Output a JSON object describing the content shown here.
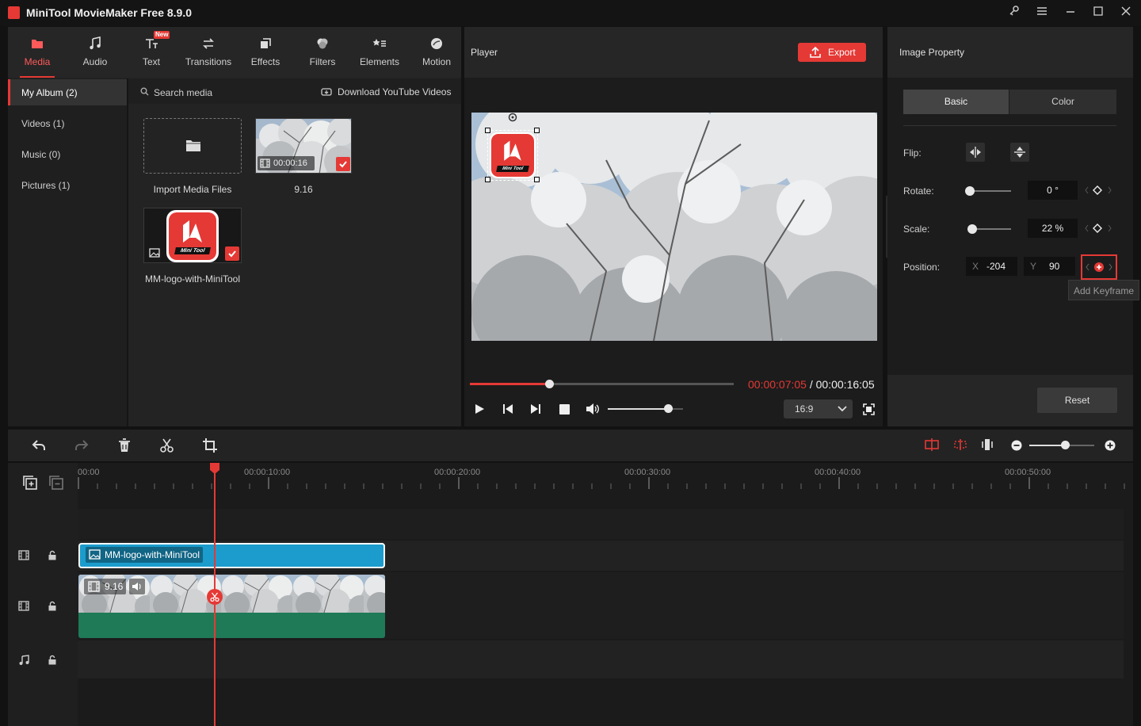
{
  "app": {
    "title": "MiniTool MovieMaker Free 8.9.0"
  },
  "toolbar": {
    "tabs": [
      {
        "label": "Media",
        "icon": "media-icon",
        "active": true
      },
      {
        "label": "Audio",
        "icon": "music-note-icon"
      },
      {
        "label": "Text",
        "icon": "text-icon",
        "badge": "New"
      },
      {
        "label": "Transitions",
        "icon": "transitions-icon"
      },
      {
        "label": "Effects",
        "icon": "effects-icon"
      },
      {
        "label": "Filters",
        "icon": "filters-icon"
      },
      {
        "label": "Elements",
        "icon": "elements-icon"
      },
      {
        "label": "Motion",
        "icon": "motion-icon"
      }
    ]
  },
  "library": {
    "albums": [
      {
        "label": "My Album (2)",
        "active": true
      },
      {
        "label": "Videos (1)"
      },
      {
        "label": "Music (0)"
      },
      {
        "label": "Pictures (1)"
      }
    ],
    "search_placeholder": "Search media",
    "download_label": "Download YouTube Videos",
    "items": [
      {
        "label": "Import Media Files"
      },
      {
        "label": "9.16",
        "duration": "00:00:16"
      },
      {
        "label": "MM-logo-with-MiniTool"
      }
    ]
  },
  "player": {
    "title": "Player",
    "export_label": "Export",
    "overlay_logo_text": "Mini Tool",
    "time_current": "00:00:07:05",
    "time_sep": " / ",
    "time_total": "00:00:16:05",
    "progress": 0.3,
    "volume": 0.8,
    "aspect": "16:9"
  },
  "properties": {
    "title": "Image Property",
    "tabs": [
      {
        "label": "Basic",
        "active": true
      },
      {
        "label": "Color"
      }
    ],
    "flip_label": "Flip:",
    "rotate_label": "Rotate:",
    "rotate_value": "0 °",
    "rotate_level": 0.0,
    "scale_label": "Scale:",
    "scale_value": "22 %",
    "scale_level": 0.05,
    "position_label": "Position:",
    "x_label": "X",
    "x_value": "-204",
    "y_label": "Y",
    "y_value": "90",
    "tooltip": "Add Keyframe",
    "reset_label": "Reset"
  },
  "timeline": {
    "ruler": [
      "00:00",
      "00:00:10:00",
      "00:00:20:00",
      "00:00:30:00",
      "00:00:40:00",
      "00:00:50:00"
    ],
    "image_clip": "MM-logo-with-MiniTool",
    "video_clip": "9.16",
    "zoom": 0.55
  },
  "colors": {
    "accent": "#e53935",
    "clip_blue": "#1b9ccc",
    "clip_green": "#1f7a57",
    "panel": "#232323"
  }
}
